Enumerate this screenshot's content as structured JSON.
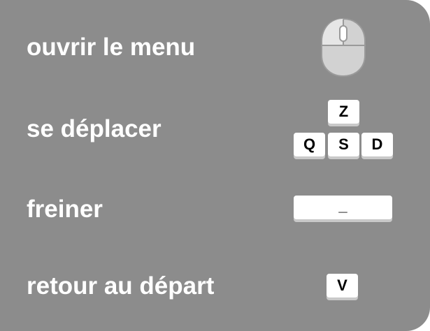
{
  "controls": {
    "menu": {
      "label": "ouvrir le menu",
      "icon": "mouse-icon"
    },
    "move": {
      "label": "se déplacer",
      "keys": {
        "up": "Z",
        "left": "Q",
        "down": "S",
        "right": "D"
      }
    },
    "brake": {
      "label": "freiner",
      "key": "_"
    },
    "reset": {
      "label": "retour au départ",
      "key": "V"
    }
  },
  "colors": {
    "panel": "#8c8c8c",
    "text": "#ffffff",
    "key": "#ffffff",
    "mouse": "#d2d2d2"
  }
}
